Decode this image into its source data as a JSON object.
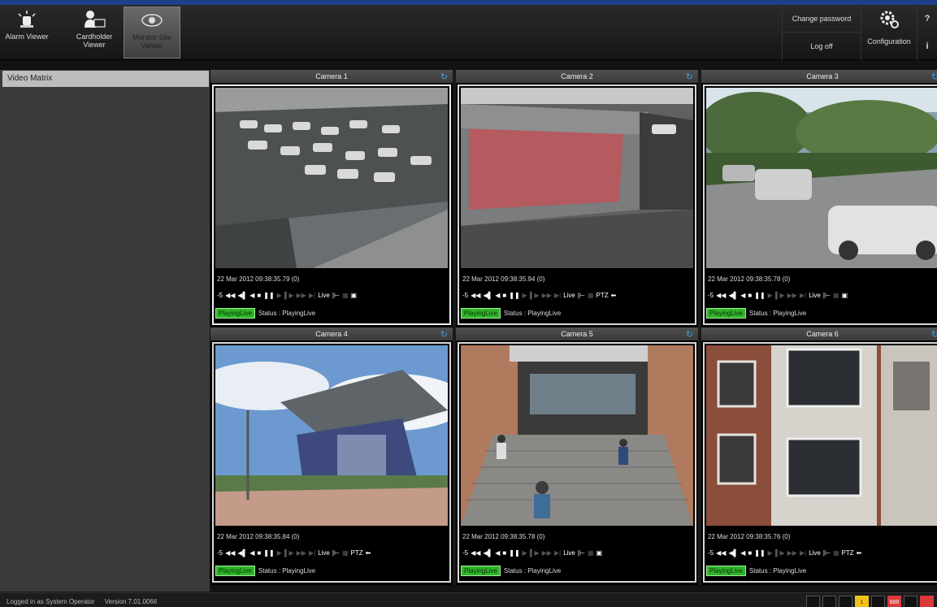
{
  "toolbar": {
    "buttons": [
      {
        "label": "Alarm Viewer",
        "icon": "alarm-siren-icon"
      },
      {
        "label": "Cardholder\nViewer",
        "icon": "cardholder-icon"
      },
      {
        "label": "Monitor Site\nViewer",
        "icon": "eye-icon"
      }
    ],
    "change_password": "Change password",
    "log_off": "Log off",
    "configuration": "Configuration",
    "help": "?",
    "info": "i"
  },
  "sidebar": {
    "items": [
      {
        "label": "Video Matrix"
      }
    ]
  },
  "cameras": [
    {
      "title": "Camera 1",
      "timestamp": "22 Mar 2012 09:38:35.79 (0)",
      "badge": "PlayingLive",
      "status": "Status : PlayingLive"
    },
    {
      "title": "Camera 2",
      "timestamp": "22 Mar 2012 09:38:35.94 (0)",
      "badge": "PlayingLive",
      "status": "Status : PlayingLive"
    },
    {
      "title": "Camera 3",
      "timestamp": "22 Mar 2012 09:38:35.78 (0)",
      "badge": "PlayingLive",
      "status": "Status : PlayingLive"
    },
    {
      "title": "Camera 4",
      "timestamp": "22 Mar 2012 09:38:35.84 (0)",
      "badge": "PlayingLive",
      "status": "Status : PlayingLive"
    },
    {
      "title": "Camera 5",
      "timestamp": "22 Mar 2012 09:38:35.78 (0)",
      "badge": "PlayingLive",
      "status": "Status : PlayingLive"
    },
    {
      "title": "Camera 6",
      "timestamp": "22 Mar 2012 09:38:35.76 (0)",
      "badge": "PlayingLive",
      "status": "Status : PlayingLive"
    }
  ],
  "controls": {
    "speed": "-5",
    "live": "Live",
    "ptz": "PTZ"
  },
  "footer": {
    "logged_in": "Logged in as System Operator",
    "version": "Version 7.01.0066"
  },
  "indicators": {
    "yellow_count": "1",
    "red_count": "888"
  },
  "colors": {
    "accent_blue": "#1e3f8a",
    "status_green": "#2fb52a",
    "refresh_blue": "#3aa0e8"
  }
}
